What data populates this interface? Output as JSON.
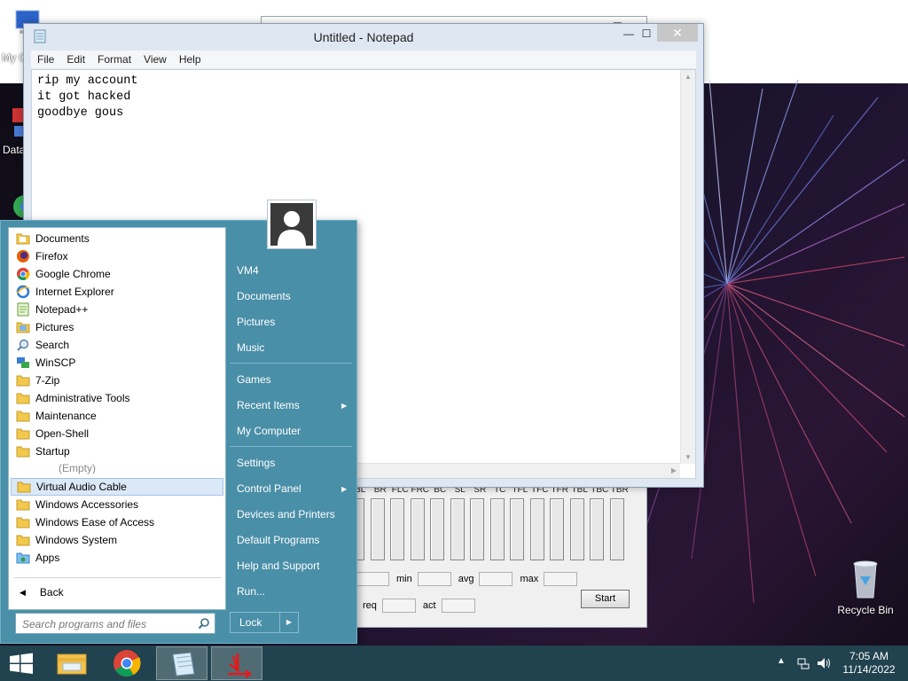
{
  "desktop": {
    "icons": [
      {
        "label": "My C"
      },
      {
        "label": "Data"
      }
    ],
    "recycle_bin_label": "Recycle Bin"
  },
  "notepad": {
    "title": "Untitled - Notepad",
    "menu": [
      "File",
      "Edit",
      "Format",
      "View",
      "Help"
    ],
    "content": "rip my account\nit got hacked\ngoodbye gous",
    "close_glyph": "✕",
    "minimize_glyph": "—",
    "maximize_glyph": "☐"
  },
  "vac_panel": {
    "channel_labels": [
      "BL",
      "BR",
      "FLC",
      "FRC",
      "BC",
      "SL",
      "SR",
      "TC",
      "TFL",
      "TFC",
      "TFR",
      "TBL",
      "TBC",
      "TBR"
    ],
    "stats_row1": {
      "min_label": "min",
      "avg_label": "avg",
      "max_label": "max"
    },
    "stats_row2": {
      "req_label": "req",
      "act_label": "act"
    },
    "start_label": "Start"
  },
  "start_menu": {
    "programs": [
      {
        "label": "Documents",
        "icon": "folder-docs-icon"
      },
      {
        "label": "Firefox",
        "icon": "firefox-icon"
      },
      {
        "label": "Google Chrome",
        "icon": "chrome-icon"
      },
      {
        "label": "Internet Explorer",
        "icon": "ie-icon"
      },
      {
        "label": "Notepad++",
        "icon": "notepadpp-icon"
      },
      {
        "label": "Pictures",
        "icon": "folder-pictures-icon"
      },
      {
        "label": "Search",
        "icon": "search-icon"
      },
      {
        "label": "WinSCP",
        "icon": "winscp-icon"
      },
      {
        "label": "7-Zip",
        "icon": "folder-icon"
      },
      {
        "label": "Administrative Tools",
        "icon": "folder-icon"
      },
      {
        "label": "Maintenance",
        "icon": "folder-icon"
      },
      {
        "label": "Open-Shell",
        "icon": "folder-icon"
      },
      {
        "label": "Startup",
        "icon": "folder-icon"
      }
    ],
    "empty_label": "(Empty)",
    "programs2": [
      {
        "label": "Virtual Audio Cable",
        "icon": "folder-icon",
        "selected": true
      },
      {
        "label": "Windows Accessories",
        "icon": "folder-icon"
      },
      {
        "label": "Windows Ease of Access",
        "icon": "folder-icon"
      },
      {
        "label": "Windows System",
        "icon": "folder-icon"
      },
      {
        "label": "Apps",
        "icon": "apps-icon"
      }
    ],
    "back_label": "Back",
    "search_placeholder": "Search programs and files",
    "right_group1": [
      "VM4",
      "Documents",
      "Pictures",
      "Music"
    ],
    "right_group2": [
      "Games",
      "Recent Items",
      "My Computer"
    ],
    "right_group3": [
      "Settings",
      "Control Panel",
      "Devices and Printers",
      "Default Programs",
      "Help and Support",
      "Run..."
    ],
    "lock_label": "Lock"
  },
  "taskbar": {
    "time": "7:05 AM",
    "date": "11/14/2022",
    "items": [
      "start-button",
      "file-explorer",
      "chrome",
      "notepad",
      "vac-app"
    ]
  },
  "colors": {
    "start_menu_bg": "#4a8fa8",
    "taskbar_bg": "#21424f",
    "selection_bg": "#dbe8f7"
  }
}
